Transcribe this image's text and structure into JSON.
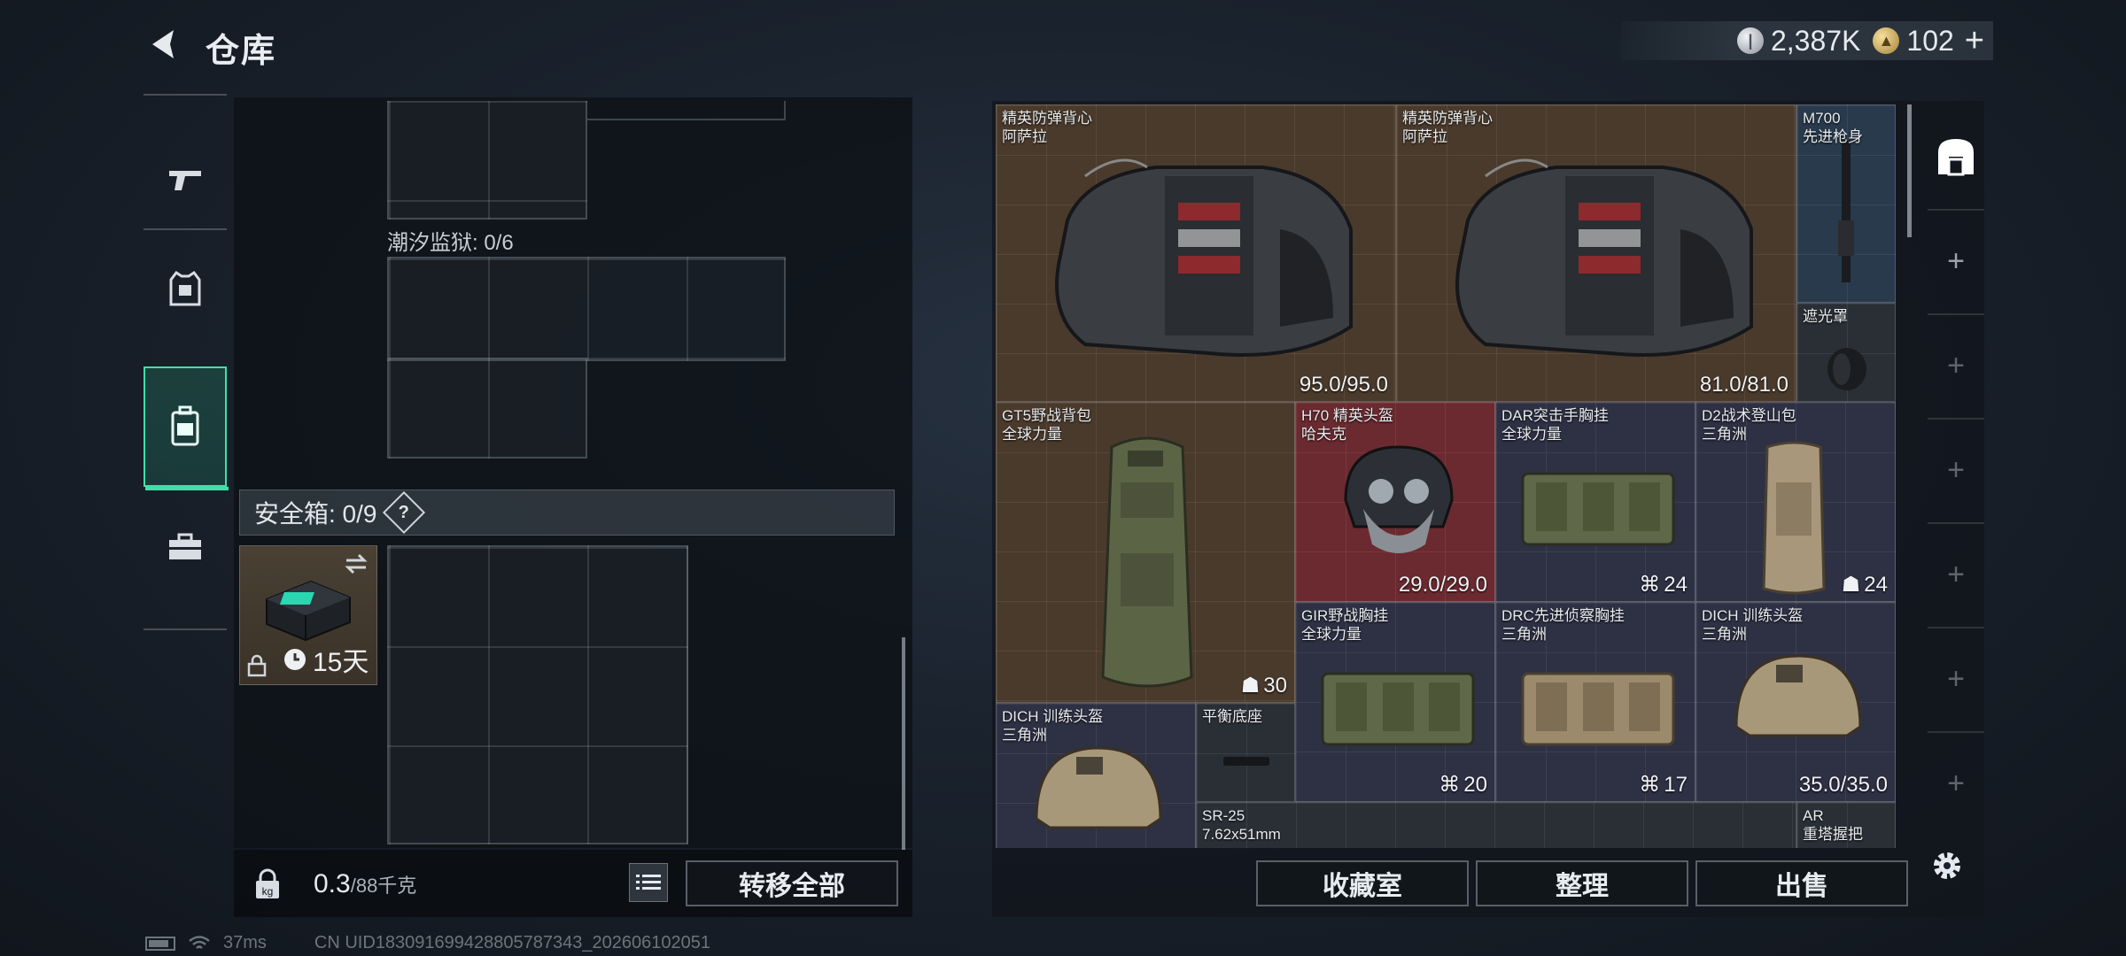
{
  "header": {
    "title": "仓库",
    "currency_silver": "2,387K",
    "currency_gold": "102",
    "plus_label": "+"
  },
  "categories": [
    {
      "icon": "pistol-icon"
    },
    {
      "icon": "armor-vest-icon"
    },
    {
      "icon": "backpack-icon",
      "active": true
    },
    {
      "icon": "toolbox-icon"
    }
  ],
  "left": {
    "tide_label": "潮汐监狱: 0/6",
    "safe_header": "安全箱: 0/9",
    "safe_help": "?",
    "safe_timer": "15天",
    "weight_value": "0.3",
    "weight_unit": "/88千克",
    "transfer_all": "转移全部"
  },
  "items": [
    {
      "name": "精英防弹背心\n阿萨拉",
      "value": "95.0/95.0"
    },
    {
      "name": "精英防弹背心\n阿萨拉",
      "value": "81.0/81.0"
    },
    {
      "name": "M700\n先进枪身",
      "value": ""
    },
    {
      "name": "遮光罩",
      "value": ""
    },
    {
      "name": "GT5野战背包\n全球力量",
      "value": "30"
    },
    {
      "name": "H70 精英头盔\n哈夫克",
      "value": "29.0/29.0"
    },
    {
      "name": "DAR突击手胸挂\n全球力量",
      "value": "24"
    },
    {
      "name": "D2战术登山包\n三角洲",
      "value": "24"
    },
    {
      "name": "GIR野战胸挂\n全球力量",
      "value": "20"
    },
    {
      "name": "DRC先进侦察胸挂\n三角洲",
      "value": "17"
    },
    {
      "name": "DICH 训练头盔\n三角洲",
      "value": "35.0/35.0"
    },
    {
      "name": "DICH 训练头盔\n三角洲",
      "value": ""
    },
    {
      "name": "平衡底座",
      "value": ""
    },
    {
      "name": "SR-25\n7.62x51mm",
      "value": ""
    },
    {
      "name": "AR\n重塔握把",
      "value": ""
    }
  ],
  "actions": {
    "collection": "收藏室",
    "sort": "整理",
    "sell": "出售"
  },
  "status": {
    "ping": "37ms",
    "uid": "CN UID1830916994288057873​43_202606102051"
  },
  "colors": {
    "accent": "#3ee0a8",
    "rarity_brown": "#4a3a2c",
    "rarity_red": "#6a2a30",
    "rarity_purple": "#2e3044",
    "rarity_blue": "#283a4c"
  }
}
